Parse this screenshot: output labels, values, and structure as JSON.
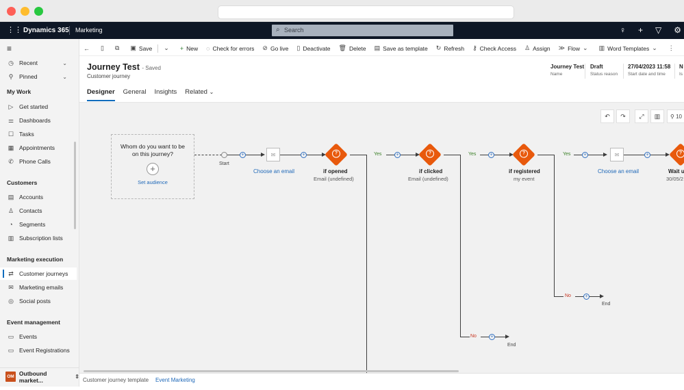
{
  "header": {
    "brand": "Dynamics 365",
    "module": "Marketing",
    "search_placeholder": "Search",
    "icons": [
      "lightbulb-icon",
      "plus-icon",
      "filter-icon",
      "settings-icon"
    ]
  },
  "sidebar": {
    "top_items": [
      {
        "label": "Recent",
        "icon": "clock-icon"
      },
      {
        "label": "Pinned",
        "icon": "pin-icon"
      }
    ],
    "sections": {
      "my_work": {
        "title": "My Work",
        "items": [
          {
            "label": "Get started"
          },
          {
            "label": "Dashboards"
          },
          {
            "label": "Tasks"
          },
          {
            "label": "Appointments"
          },
          {
            "label": "Phone Calls"
          }
        ]
      },
      "customers": {
        "title": "Customers",
        "items": [
          {
            "label": "Accounts"
          },
          {
            "label": "Contacts"
          },
          {
            "label": "Segments"
          },
          {
            "label": "Subscription lists"
          }
        ]
      },
      "marketing_execution": {
        "title": "Marketing execution",
        "items": [
          {
            "label": "Customer journeys",
            "active": true
          },
          {
            "label": "Marketing emails"
          },
          {
            "label": "Social posts"
          }
        ]
      },
      "event_management": {
        "title": "Event management",
        "items": [
          {
            "label": "Events"
          },
          {
            "label": "Event Registrations"
          }
        ]
      }
    },
    "area_badge": "OM",
    "area_label": "Outbound market..."
  },
  "commandbar": {
    "items": [
      "Save",
      "New",
      "Check for errors",
      "Go live",
      "Deactivate",
      "Delete",
      "Save as template",
      "Refresh",
      "Check Access",
      "Assign",
      "Flow",
      "Word Templates"
    ]
  },
  "record": {
    "title": "Journey Test",
    "saved": "- Saved",
    "entity": "Customer journey",
    "fields": [
      {
        "value": "Journey Test",
        "label": "Name"
      },
      {
        "value": "Draft",
        "label": "Status reason"
      },
      {
        "value": "27/04/2023 11:58",
        "label": "Start date and time"
      },
      {
        "value": "N",
        "label": "Is"
      }
    ],
    "tabs": [
      "Designer",
      "General",
      "Insights",
      "Related"
    ]
  },
  "canvas": {
    "zoom": "10",
    "audience_question": "Whom do you want to be on this journey?",
    "set_audience": "Set audience",
    "start": "Start",
    "choose_email": "Choose an email",
    "conditions": [
      {
        "title": "if opened",
        "sub": "Email (undefined)"
      },
      {
        "title": "if clicked",
        "sub": "Email (undefined)"
      },
      {
        "title": "if registered",
        "sub": "my event"
      }
    ],
    "wait": {
      "title": "Wait u",
      "sub": "30/05/2"
    },
    "yes": "Yes",
    "no": "No",
    "end": "End"
  },
  "footer": {
    "template_label": "Customer journey template",
    "template_value": "Event Marketing"
  }
}
